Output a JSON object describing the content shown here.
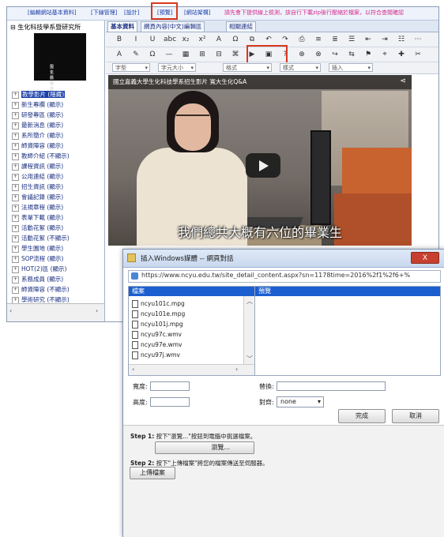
{
  "topbar": {
    "links": [
      "[編輯網站基本資料]",
      "[下線管理]",
      "[設計]",
      "[預覽]",
      "[網站架構]"
    ],
    "notice": "請先會下提供線上檢測，該自行下載zip後行壓縮於檔案，以符合查閱確認"
  },
  "tree": {
    "root": "生化科技學系暨研究所",
    "thumb_text": [
      "國立嘉義大學",
      "生化科技學系"
    ],
    "items": [
      {
        "label": "教學影片 (隱藏)",
        "selected": true
      },
      {
        "label": "新生專欄 (顯示)"
      },
      {
        "label": "研發專區 (顯示)"
      },
      {
        "label": "最新消息 (顯示)"
      },
      {
        "label": "系所簡介 (顯示)"
      },
      {
        "label": "師資陣容 (顯示)"
      },
      {
        "label": "教師介紹 (不顯示)"
      },
      {
        "label": "課程資訊 (顯示)"
      },
      {
        "label": "公用連結 (顯示)"
      },
      {
        "label": "招生資訊 (顯示)"
      },
      {
        "label": "會議記錄 (顯示)"
      },
      {
        "label": "法規章程 (顯示)"
      },
      {
        "label": "表單下載 (顯示)"
      },
      {
        "label": "活動花絮 (顯示)"
      },
      {
        "label": "活動花絮 (不顯示)"
      },
      {
        "label": "學生園地 (顯示)"
      },
      {
        "label": "SOP流程 (顯示)"
      },
      {
        "label": "HOT(2)區 (顯示)"
      },
      {
        "label": "系務成員 (顯示)"
      },
      {
        "label": "師資陣容 (不顯示)"
      },
      {
        "label": "學術研究 (不顯示)"
      }
    ]
  },
  "editor": {
    "tabs": [
      "基本資料",
      "網頁內容(中文)編輯區",
      "相關連結"
    ],
    "toolbar1": [
      "B",
      "I",
      "U",
      "abc",
      "x₂",
      "x²",
      "A",
      "Ω",
      "⧉",
      "↶",
      "↷",
      "⎙",
      "≡",
      "≣",
      "☰",
      "⇤",
      "⇥",
      "☷",
      "⋯"
    ],
    "toolbar2": [
      "A",
      "✎",
      "Ω",
      "—",
      "▦",
      "⊞",
      "⊟",
      "⌘",
      "▶",
      "▣",
      "?",
      "⊕",
      "⊗",
      "↪",
      "⇆",
      "⚑",
      "⌖",
      "✚",
      "✂"
    ],
    "selects": [
      "字型",
      "字元大小",
      "格式",
      "樣式",
      "插入"
    ]
  },
  "video": {
    "title": "國立嘉義大學生化科技學系招生影片   寬大生化Q&A",
    "subtitle": "我們總共大概有六位的畢業生"
  },
  "dialog": {
    "title": "插入Windows媒體 -- 網頁對話",
    "close": "X",
    "url": "https://www.ncyu.edu.tw/site_detail_content.aspx?sn=1178time=2016%2f1%2f6+%",
    "file_header": "檔案",
    "preview_header": "預覽",
    "files": [
      "ncyu101c.mpg",
      "ncyu101e.mpg",
      "ncyu101j.mpg",
      "ncyu97c.wmv",
      "ncyu97e.wmv",
      "ncyu97j.wmv"
    ],
    "labels": {
      "width": "寬度:",
      "height": "高度:",
      "alt": "替換:",
      "align": "對齊:"
    },
    "align_value": "none",
    "ok": "完成",
    "cancel": "取消",
    "step1": {
      "prefix": "Step 1:",
      "text": "按下\"瀏覽...\"按鈕到電腦中挑選檔案。",
      "button": "瀏覽..."
    },
    "step2": {
      "prefix": "Step 2:",
      "text": "按下\"上傳檔案\"將您的檔案傳送至伺服器。",
      "button": "上傳檔案"
    }
  }
}
